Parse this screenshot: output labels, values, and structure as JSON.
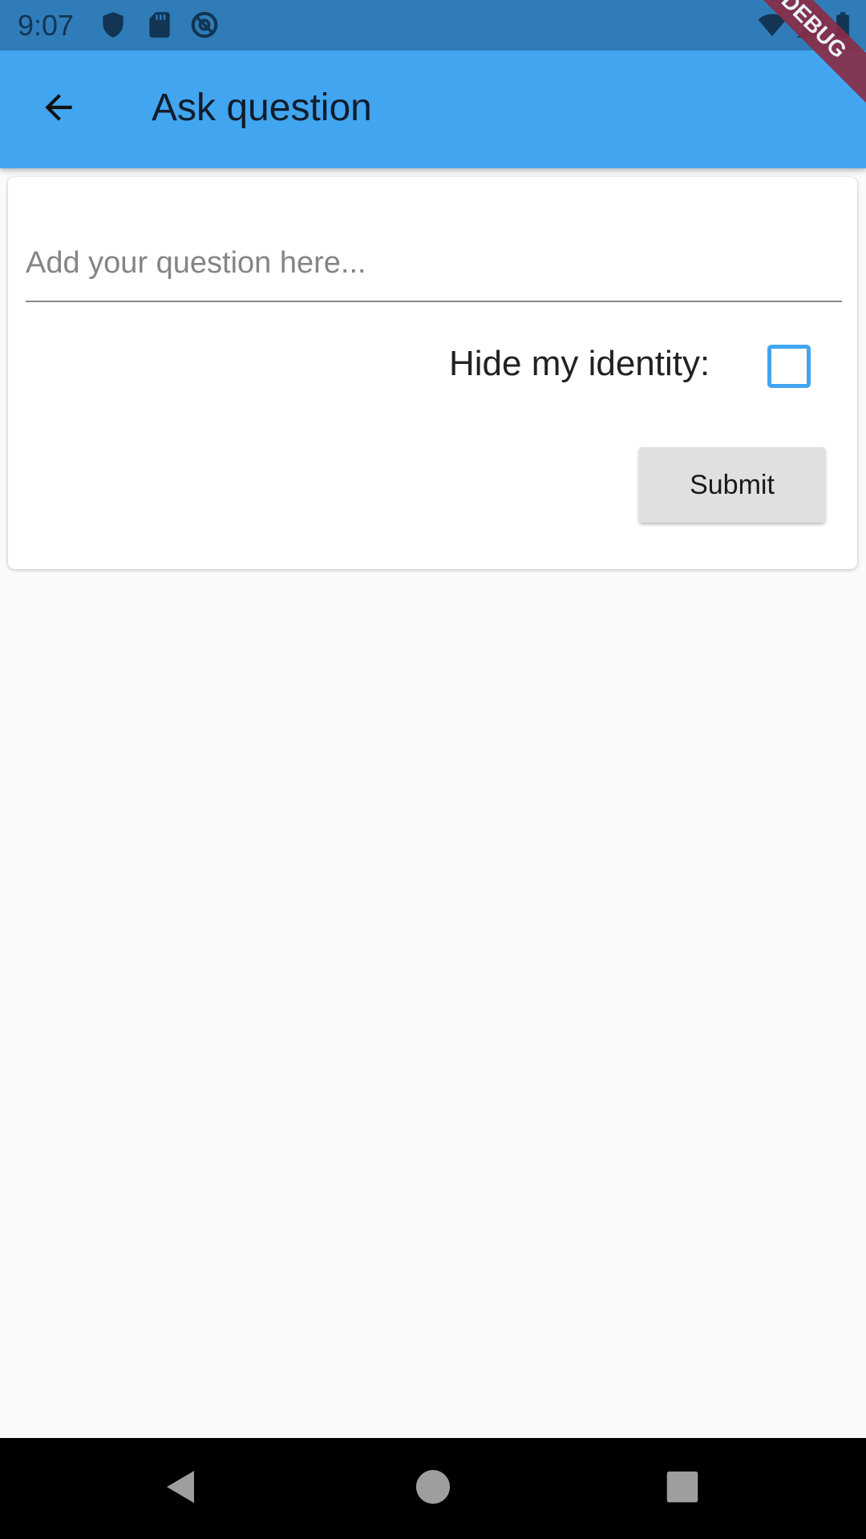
{
  "status_bar": {
    "time": "9:07",
    "left_icons": [
      "shield-icon",
      "sd-card-icon",
      "do-not-disturb-icon"
    ],
    "right_icons": [
      "wifi-icon",
      "signal-icon",
      "battery-icon"
    ]
  },
  "app_bar": {
    "title": "Ask question",
    "back_icon": "arrow-back-icon",
    "color": "#42a5f0"
  },
  "debug_banner": {
    "label": "DEBUG"
  },
  "form": {
    "question_placeholder": "Add your question here...",
    "question_value": "",
    "hide_identity_label": "Hide my identity:",
    "hide_identity_checked": false,
    "submit_label": "Submit"
  },
  "nav_bar": {
    "buttons": [
      "back-triangle-icon",
      "home-circle-icon",
      "recents-square-icon"
    ]
  }
}
